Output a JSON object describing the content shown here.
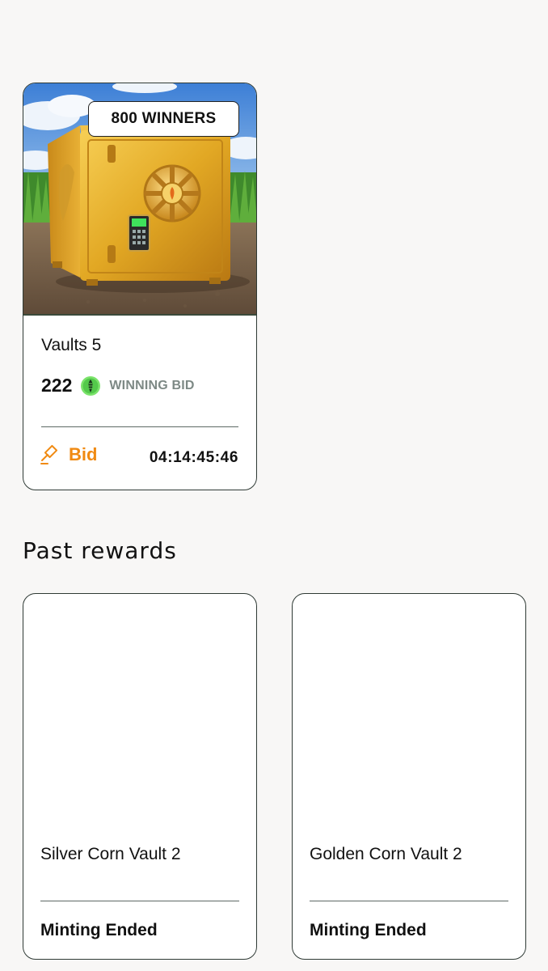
{
  "featured": {
    "badge": "800 WINNERS",
    "title": "Vaults 5",
    "bid_amount": "222",
    "bid_caption": "WINNING BID",
    "action_label": "Bid",
    "countdown": "04:14:45:46",
    "token_icon": "corn-token-icon",
    "accent_color": "#f08a12"
  },
  "past_rewards": {
    "heading": "Past rewards",
    "items": [
      {
        "title": "Silver Corn Vault 2",
        "status": "Minting Ended"
      },
      {
        "title": "Golden Corn Vault 2",
        "status": "Minting Ended"
      }
    ]
  }
}
